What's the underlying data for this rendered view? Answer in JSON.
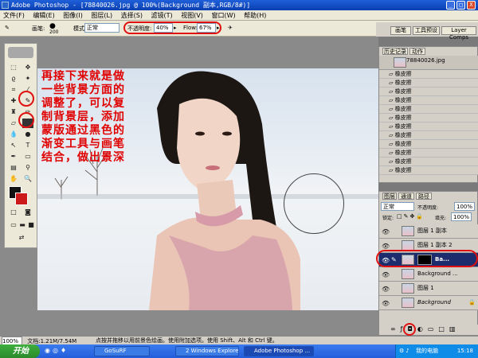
{
  "window": {
    "title": "Adobe Photoshop - [78840026.jpg @ 100%(Background 副本,RGB/8#)]",
    "min_glyph": "_",
    "max_glyph": "□",
    "close_glyph": "X"
  },
  "menu": [
    "文件(F)",
    "编辑(E)",
    "图像(I)",
    "图层(L)",
    "选择(S)",
    "滤镜(T)",
    "视图(V)",
    "窗口(W)",
    "帮助(H)"
  ],
  "options": {
    "brush_label": "画笔:",
    "brush_size": "200",
    "mode_label": "模式:",
    "mode_value": "正常",
    "opacity_label": "不透明度:",
    "opacity_value": "40%",
    "flow_label": "Flow:",
    "flow_value": "67%"
  },
  "palette_well": [
    "画笔",
    "工具预设",
    "Layer Comps"
  ],
  "caption": "再接下来就是做一些背景方面的调整了，可以复制背景层，添加蒙版通过黑色的渐变工具与画笔结合，做出景深",
  "history": {
    "tabs": [
      "历史记录",
      "动作"
    ],
    "snapshot": "78840026.jpg",
    "steps": [
      "橡皮擦",
      "橡皮擦",
      "橡皮擦",
      "橡皮擦",
      "橡皮擦",
      "橡皮擦",
      "橡皮擦",
      "橡皮擦",
      "橡皮擦",
      "橡皮擦",
      "橡皮擦",
      "橡皮擦"
    ]
  },
  "layers": {
    "tabs": [
      "图层",
      "通道",
      "路径"
    ],
    "blend_mode": "正常",
    "opacity_label": "不透明度:",
    "opacity_value": "100%",
    "lock_label": "锁定:",
    "fill_label": "填充:",
    "fill_value": "100%",
    "items": [
      "图层 1 副本",
      "图层 1 副本 2",
      "Ba...",
      "Background ...",
      "图层 1",
      "Background"
    ]
  },
  "status": {
    "zoom": "100%",
    "doc": "文档:1.21M/7.54M",
    "hint": "点按并拖移以用前景色绘画。使用附加选项。使用 Shift、Alt 和 Ctrl 键。"
  },
  "taskbar": {
    "start": "开始",
    "tasks": [
      "GoSuRF",
      "2 Windows Explorer",
      "Adobe Photoshop ..."
    ],
    "tray_label": "我的电脑",
    "time": "15:18"
  },
  "colors": {
    "annotation": "#e00000",
    "foreground": "#111111",
    "background": "#cc1a1a",
    "selected_layer": "#1c2c6c"
  }
}
